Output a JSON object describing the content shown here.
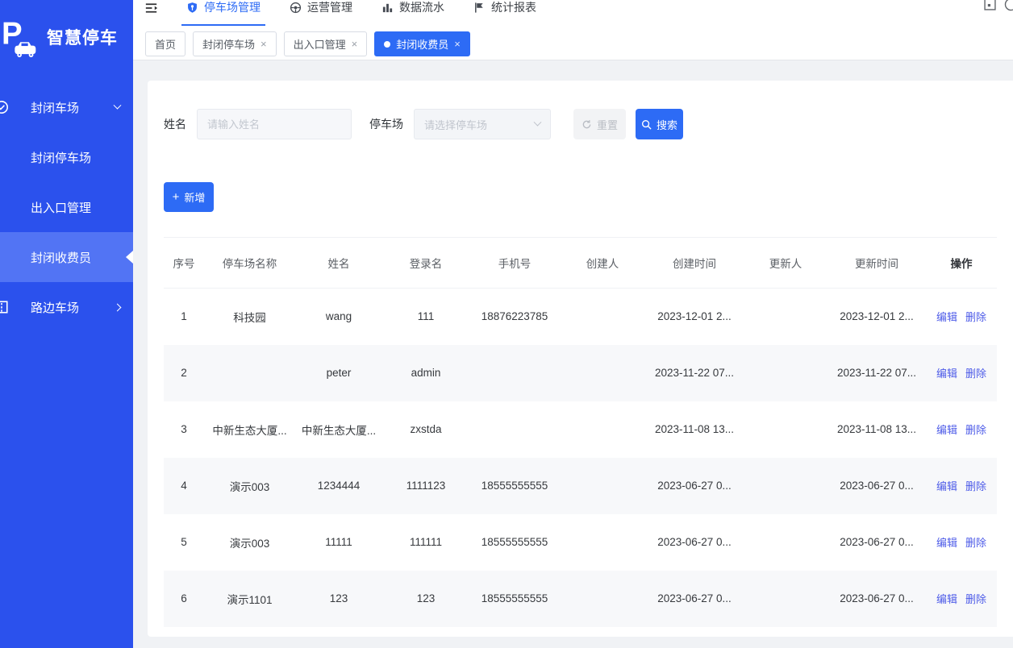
{
  "brand": {
    "title": "智慧停车"
  },
  "colors": {
    "primary": "#2d6bf5",
    "sidebar": "#2b51ed",
    "sidebar_active": "#5274f4",
    "link": "#4d5be8",
    "page_bg": "#f0f2f5",
    "stripe": "#f7f8fa"
  },
  "topnav": {
    "items": [
      {
        "key": "parking-management",
        "label": "停车场管理",
        "icon": "shield-icon",
        "active": true
      },
      {
        "key": "operations-management",
        "label": "运营管理",
        "icon": "steering-wheel-icon",
        "active": false
      },
      {
        "key": "data-flow",
        "label": "数据流水",
        "icon": "bar-chart-icon",
        "active": false
      },
      {
        "key": "statistics-report",
        "label": "统计报表",
        "icon": "flag-icon",
        "active": false
      }
    ]
  },
  "tabs": [
    {
      "key": "home",
      "label": "首页",
      "closable": false,
      "active": false
    },
    {
      "key": "closed-parking-lot",
      "label": "封闭停车场",
      "closable": true,
      "active": false
    },
    {
      "key": "entrance-exit-management",
      "label": "出入口管理",
      "closable": true,
      "active": false
    },
    {
      "key": "closed-toll-collector",
      "label": "封闭收费员",
      "closable": true,
      "active": true
    }
  ],
  "sidebar": {
    "items": [
      {
        "key": "closed-parking",
        "label": "封闭车场",
        "type": "group",
        "icon": "closed-parking-icon",
        "expanded": true,
        "active": false
      },
      {
        "key": "closed-parking-lot",
        "label": "封闭停车场",
        "type": "child",
        "active": false
      },
      {
        "key": "entrance-exit-management",
        "label": "出入口管理",
        "type": "child",
        "active": false
      },
      {
        "key": "closed-toll-collector",
        "label": "封闭收费员",
        "type": "child",
        "active": true
      },
      {
        "key": "roadside-parking",
        "label": "路边车场",
        "type": "group",
        "icon": "roadside-parking-icon",
        "expanded": false,
        "active": false
      }
    ]
  },
  "search": {
    "name_label": "姓名",
    "name_placeholder": "请输入姓名",
    "park_label": "停车场",
    "park_placeholder": "请选择停车场",
    "reset_label": "重置",
    "search_label": "搜索"
  },
  "toolbar": {
    "add_label": "新增"
  },
  "table": {
    "columns": [
      "序号",
      "停车场名称",
      "姓名",
      "登录名",
      "手机号",
      "创建人",
      "创建时间",
      "更新人",
      "更新时间",
      "操作"
    ],
    "edit_label": "编辑",
    "delete_label": "删除",
    "rows": [
      [
        "1",
        "科技园",
        "wang",
        "111",
        "18876223785",
        "",
        "2023-12-01 2...",
        "",
        "2023-12-01 2..."
      ],
      [
        "2",
        "",
        "peter",
        "admin",
        "",
        "",
        "2023-11-22 07...",
        "",
        "2023-11-22 07..."
      ],
      [
        "3",
        "中新生态大厦...",
        "中新生态大厦...",
        "zxstda",
        "",
        "",
        "2023-11-08 13...",
        "",
        "2023-11-08 13..."
      ],
      [
        "4",
        "演示003",
        "1234444",
        "1111123",
        "18555555555",
        "",
        "2023-06-27 0...",
        "",
        "2023-06-27 0..."
      ],
      [
        "5",
        "演示003",
        "11111",
        "111111",
        "18555555555",
        "",
        "2023-06-27 0...",
        "",
        "2023-06-27 0..."
      ],
      [
        "6",
        "演示1101",
        "123",
        "123",
        "18555555555",
        "",
        "2023-06-27 0...",
        "",
        "2023-06-27 0..."
      ]
    ]
  }
}
